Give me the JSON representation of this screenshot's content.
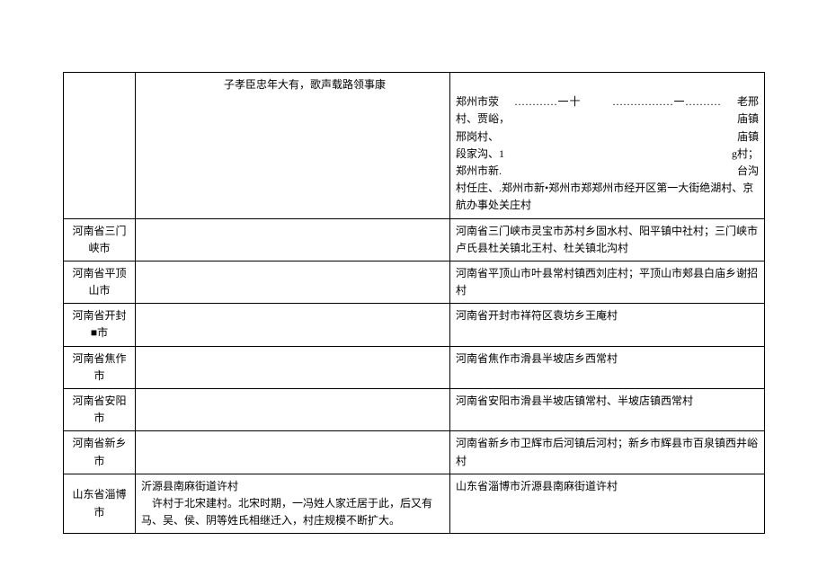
{
  "rows": [
    {
      "region": "",
      "desc_poem": "子孝臣忠年大有，歌声载路领事康",
      "loc_lines": [
        {
          "left": "郑州市荥",
          "mid": "............一十",
          "mid2": ".................一..........",
          "right": "老邢"
        },
        {
          "left": "村、贾峪，",
          "right": "庙镇"
        },
        {
          "left": "邢岗村、",
          "right": "庙镇"
        },
        {
          "left": "段家沟、1",
          "right": "g村；"
        },
        {
          "left": "郑州市新.",
          "right": "台沟"
        }
      ],
      "loc_tail": "村任庄、.郑州市新•郑州市郑郑州市经开区第一大街绝湖村、京航办事处关庄村"
    },
    {
      "region": "河南省三门峡市",
      "desc": "",
      "loc": "河南省三门峡市灵宝市苏村乡固水村、阳平镇中社村；三门峡市卢氏县杜关镇北王村、杜关镇北沟村"
    },
    {
      "region": "河南省平顶山市",
      "desc": "",
      "loc": "河南省平顶山市叶县常村镇西刘庄村；平顶山市郏县白庙乡谢招村"
    },
    {
      "region": "河南省开封■市",
      "desc": "",
      "loc": "河南省开封市祥符区袁坊乡王庵村"
    },
    {
      "region": "河南省焦作市",
      "desc": "",
      "loc": "河南省焦作市滑县半坡店乡西常村"
    },
    {
      "region": "河南省安阳市",
      "desc": "",
      "loc": "河南省安阳市滑县半坡店镇常村、半坡店镇西常村"
    },
    {
      "region": "河南省新乡市",
      "desc": "",
      "loc": "河南省新乡市卫辉市后河镇后河村；新乡市辉县市百泉镇西井峪村"
    },
    {
      "region": "山东省淄博市",
      "desc_title": "沂源县南麻街道许村",
      "desc_body": "许村于北宋建村。北宋时期，一冯姓人家迁居于此，后又有马、吴、侯、阴等姓氏相继迁入，村庄规模不断扩大。",
      "loc": "山东省淄博市沂源县南麻街道许村"
    }
  ]
}
